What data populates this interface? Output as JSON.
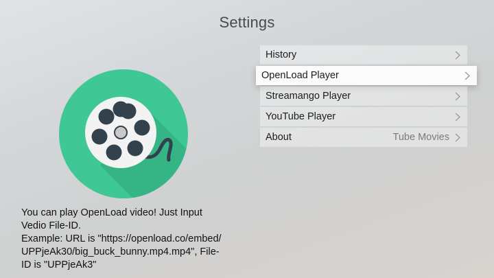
{
  "page": {
    "title": "Settings"
  },
  "menu": {
    "items": [
      {
        "label": "History",
        "value": ""
      },
      {
        "label": "OpenLoad Player",
        "value": ""
      },
      {
        "label": "Streamango Player",
        "value": ""
      },
      {
        "label": "YouTube Player",
        "value": ""
      },
      {
        "label": "About",
        "value": "Tube Movies"
      }
    ],
    "focused_index": 1
  },
  "description": "You can play OpenLoad video! Just Input\nVedio File-ID.\n Example: URL is \"https://openload.co/embed/\nUPPjeAk30/big_buck_bunny.mp4.mp4\", File-\nID is \"UPPjeAk3\"",
  "colors": {
    "logo_circle": "#3fc896",
    "reel": "#f3f3f3",
    "reel_holes": "#33414d",
    "shadow": "#2f9e73"
  },
  "icons": {
    "logo": "film-reel-icon",
    "chevron": "chevron-right-icon"
  }
}
